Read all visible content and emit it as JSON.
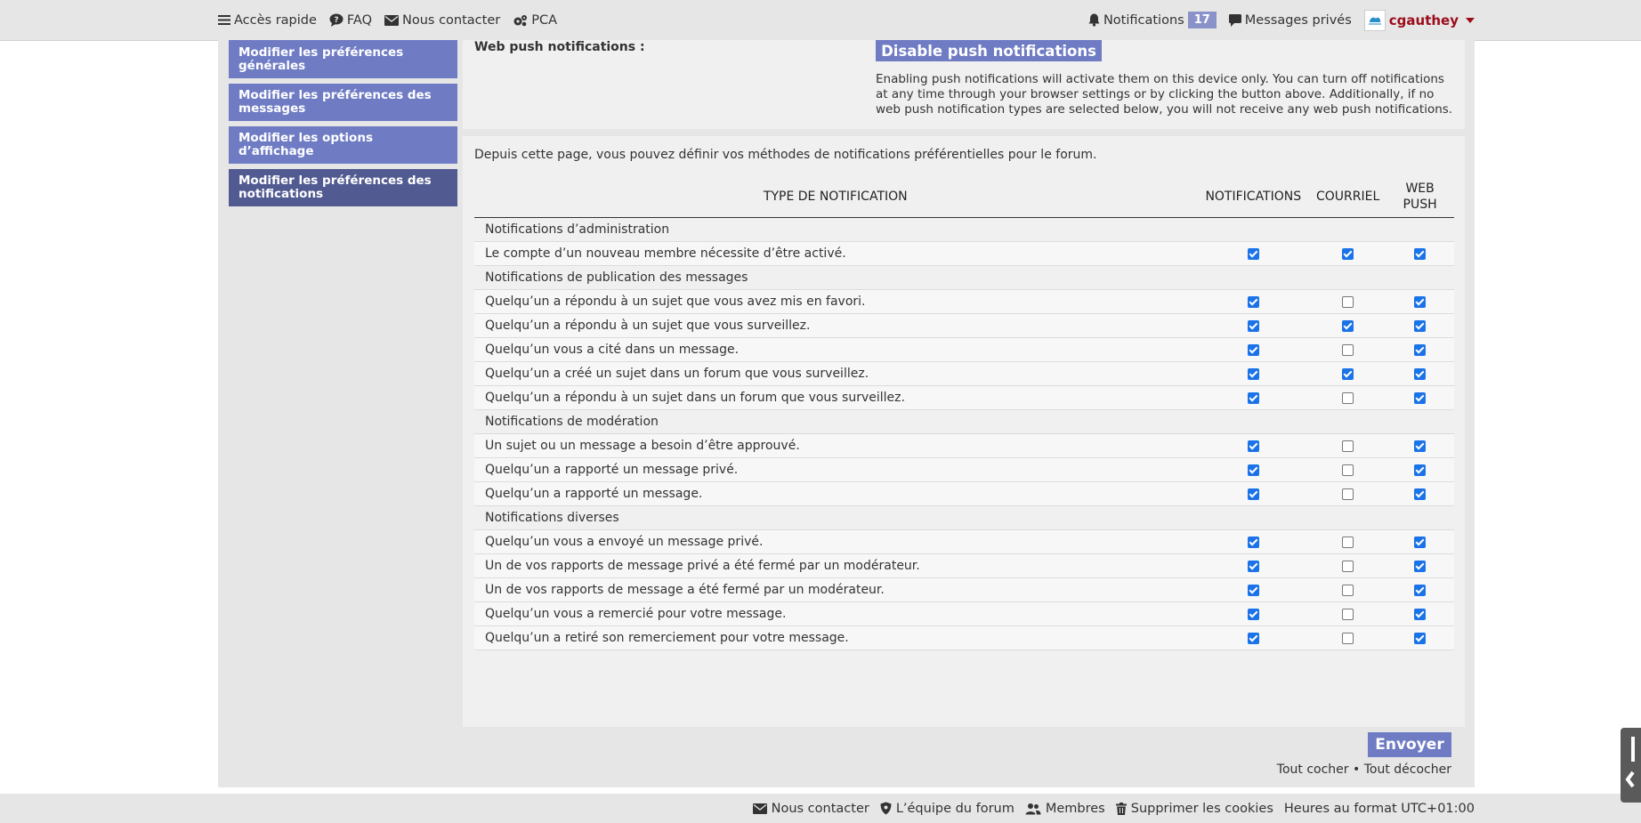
{
  "topbar": {
    "quick_access": "Accès rapide",
    "faq": "FAQ",
    "contact": "Nous contacter",
    "acp": "PCA",
    "notifications": "Notifications",
    "notifications_count": "17",
    "private_messages": "Messages privés",
    "username": "cgauthey",
    "icons": [
      "menu-icon",
      "question-icon",
      "envelope-icon",
      "gears-icon",
      "bell-icon",
      "comment-icon",
      "avatar",
      "caret-down-icon"
    ]
  },
  "sidebar": {
    "items": [
      {
        "label": "Modifier les préférences générales"
      },
      {
        "label": "Modifier les préférences des messages"
      },
      {
        "label": "Modifier les options d’affichage"
      },
      {
        "label": "Modifier les préférences des notifications"
      }
    ]
  },
  "webpush": {
    "label": "Web push notifications :",
    "button": "Disable push notifications",
    "description": "Enabling push notifications will activate them on this device only. You can turn off notifications at any time through your browser settings or by clicking the button above. Additionally, if no web push notification types are selected below, you will not receive any web push notifications."
  },
  "intro": "Depuis cette page, vous pouvez définir vos méthodes de notifications préférentielles pour le forum.",
  "table": {
    "headers": {
      "type": "TYPE DE NOTIFICATION",
      "notifications": "NOTIFICATIONS",
      "email": "COURRIEL",
      "webpush": "WEB PUSH"
    },
    "groups": [
      {
        "title": "Notifications d’administration",
        "rows": [
          {
            "label": "Le compte d’un nouveau membre nécessite d’être activé.",
            "notif": true,
            "email": true,
            "push": true
          }
        ]
      },
      {
        "title": "Notifications de publication des messages",
        "rows": [
          {
            "label": "Quelqu’un a répondu à un sujet que vous avez mis en favori.",
            "notif": true,
            "email": false,
            "push": true
          },
          {
            "label": "Quelqu’un a répondu à un sujet que vous surveillez.",
            "notif": true,
            "email": true,
            "push": true
          },
          {
            "label": "Quelqu’un vous a cité dans un message.",
            "notif": true,
            "email": false,
            "push": true
          },
          {
            "label": "Quelqu’un a créé un sujet dans un forum que vous surveillez.",
            "notif": true,
            "email": true,
            "push": true
          },
          {
            "label": "Quelqu’un a répondu à un sujet dans un forum que vous surveillez.",
            "notif": true,
            "email": false,
            "push": true
          }
        ]
      },
      {
        "title": "Notifications de modération",
        "rows": [
          {
            "label": "Un sujet ou un message a besoin d’être approuvé.",
            "notif": true,
            "email": false,
            "push": true
          },
          {
            "label": "Quelqu’un a rapporté un message privé.",
            "notif": true,
            "email": false,
            "push": true
          },
          {
            "label": "Quelqu’un a rapporté un message.",
            "notif": true,
            "email": false,
            "push": true
          }
        ]
      },
      {
        "title": "Notifications diverses",
        "rows": [
          {
            "label": "Quelqu’un vous a envoyé un message privé.",
            "notif": true,
            "email": false,
            "push": true
          },
          {
            "label": "Un de vos rapports de message privé a été fermé par un modérateur.",
            "notif": true,
            "email": false,
            "push": true
          },
          {
            "label": "Un de vos rapports de message a été fermé par un modérateur.",
            "notif": true,
            "email": false,
            "push": true
          },
          {
            "label": "Quelqu’un vous a remercié pour votre message.",
            "notif": true,
            "email": false,
            "push": true
          },
          {
            "label": "Quelqu’un a retiré son remerciement pour votre message.",
            "notif": true,
            "email": false,
            "push": true
          }
        ]
      }
    ]
  },
  "actions": {
    "submit": "Envoyer",
    "check_all": "Tout cocher",
    "separator": "•",
    "uncheck_all": "Tout décocher"
  },
  "footer": {
    "contact": "Nous contacter",
    "team": "L’équipe du forum",
    "members": "Membres",
    "delete_cookies": "Supprimer les cookies",
    "timezone": "Heures au format UTC+01:00"
  },
  "colors": {
    "accent": "#6f7cc4",
    "accent_active": "#525b91",
    "username": "#9b0b1a",
    "checkbox": "#1a73e8",
    "badge": "#8a93c9"
  }
}
